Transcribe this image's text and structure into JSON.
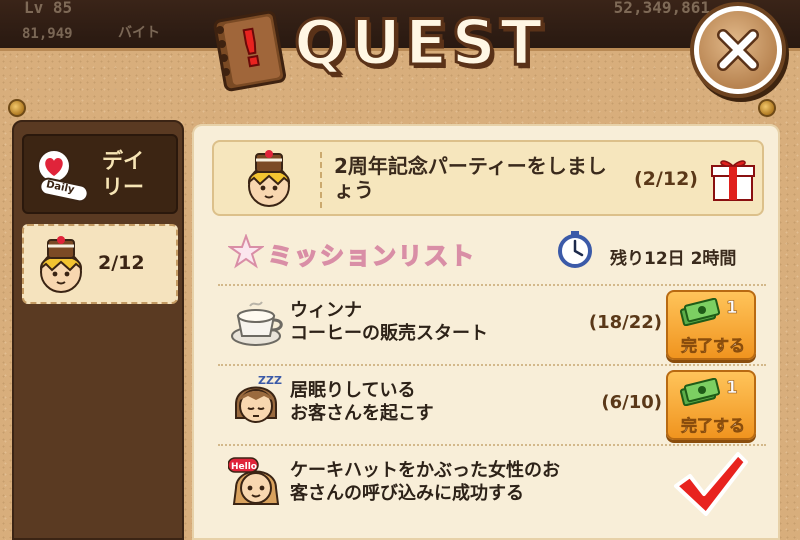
{
  "background_hud": {
    "level": "Lv 85",
    "exp": "81,949",
    "bait": "バイト",
    "money": "52,349,861"
  },
  "header": {
    "title": "QUEST",
    "close_icon": "close-icon"
  },
  "sidebar": {
    "tabs": [
      {
        "label": "デイ\nリー",
        "badge": "Daily",
        "icon": "daily-heart-icon",
        "selected": false
      },
      {
        "label": "2/12",
        "icon": "chef-girl-avatar-icon",
        "selected": true
      }
    ]
  },
  "goal": {
    "text": "2周年記念パーティーをしましょう",
    "progress": "(2/12)",
    "reward_icon": "gift-box-icon"
  },
  "missions_header": {
    "title": "ミッションリスト",
    "time_left": "残り12日 2時間",
    "timer_icon": "stopwatch-icon"
  },
  "missions": [
    {
      "line1": "ウィンナ",
      "line2": "コーヒーの販売スタート",
      "progress": "(18/22)",
      "reward_qty": "1",
      "button": "完了する",
      "icon": "coffee-cup-icon",
      "done": false
    },
    {
      "line1": "居眠りしている",
      "line2": "お客さんを起こす",
      "progress": "(6/10)",
      "reward_qty": "1",
      "button": "完了する",
      "icon": "sleeping-customer-icon",
      "done": false
    },
    {
      "line1": "ケーキハットをかぶった女性のお",
      "line2": "客さんの呼び込みに成功する",
      "progress": "",
      "reward_qty": "",
      "button": "",
      "icon": "hello-girl-icon",
      "done": true
    }
  ],
  "colors": {
    "panel": "#d8ae7c",
    "content": "#f8eed8",
    "button_orange": "#f0941f",
    "check_red": "#e8231f",
    "title_stroke": "#5a3218"
  }
}
